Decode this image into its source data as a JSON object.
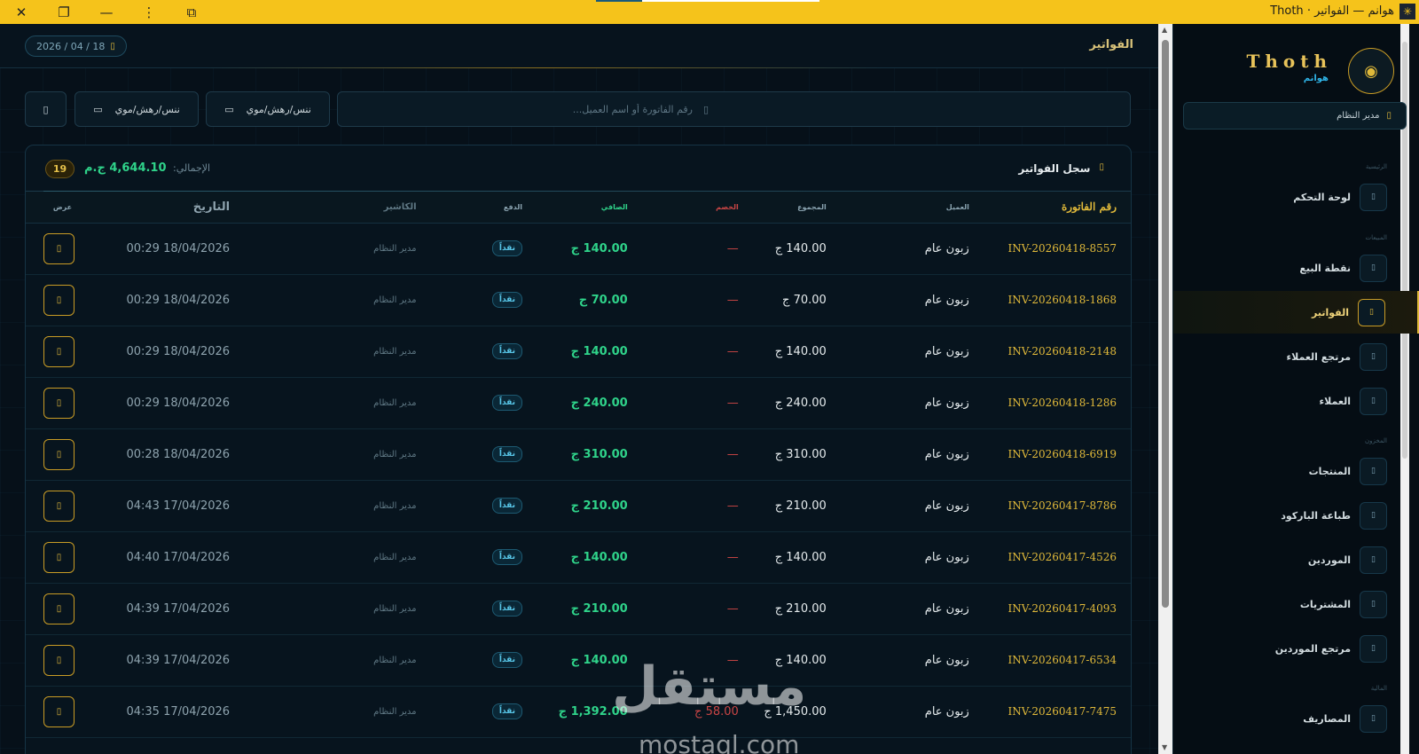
{
  "window": {
    "title": "هوانم — الفواتير · Thoth"
  },
  "header": {
    "page_title": "الفواتير",
    "date": "2026 / 04 / 18"
  },
  "filters": {
    "search_placeholder": "رقم الفاتورة أو اسم العميل...",
    "date_from_placeholder": "ﻧﻨﺲ/ﺭﻫﺶ/ﻣﻮﻱ",
    "date_to_placeholder": "ﻧﻨﺲ/ﺭﻫﺶ/ﻣﻮﻱ"
  },
  "card": {
    "title": "سجل الفواتير",
    "total_label": "الإجمالي:",
    "total_value": "4,644.10 ج.م",
    "count": "19"
  },
  "table": {
    "headers": {
      "invoice": "رقم الفاتورة",
      "customer": "العميل",
      "total": "المجموع",
      "discount": "الخصم",
      "net": "الصافي",
      "payment": "الدفع",
      "cashier": "الكاشير",
      "date": "التاريخ",
      "view": "عرض"
    },
    "rows": [
      {
        "invoice": "INV-20260418-8557",
        "customer": "زبون عام",
        "total": "140.00 ج",
        "discount": "—",
        "net": "140.00 ج",
        "payment": "نقداً",
        "cashier": "مدير النظام",
        "date": "18/04/2026 00:29"
      },
      {
        "invoice": "INV-20260418-1868",
        "customer": "زبون عام",
        "total": "70.00 ج",
        "discount": "—",
        "net": "70.00 ج",
        "payment": "نقداً",
        "cashier": "مدير النظام",
        "date": "18/04/2026 00:29"
      },
      {
        "invoice": "INV-20260418-2148",
        "customer": "زبون عام",
        "total": "140.00 ج",
        "discount": "—",
        "net": "140.00 ج",
        "payment": "نقداً",
        "cashier": "مدير النظام",
        "date": "18/04/2026 00:29"
      },
      {
        "invoice": "INV-20260418-1286",
        "customer": "زبون عام",
        "total": "240.00 ج",
        "discount": "—",
        "net": "240.00 ج",
        "payment": "نقداً",
        "cashier": "مدير النظام",
        "date": "18/04/2026 00:29"
      },
      {
        "invoice": "INV-20260418-6919",
        "customer": "زبون عام",
        "total": "310.00 ج",
        "discount": "—",
        "net": "310.00 ج",
        "payment": "نقداً",
        "cashier": "مدير النظام",
        "date": "18/04/2026 00:28"
      },
      {
        "invoice": "INV-20260417-8786",
        "customer": "زبون عام",
        "total": "210.00 ج",
        "discount": "—",
        "net": "210.00 ج",
        "payment": "نقداً",
        "cashier": "مدير النظام",
        "date": "17/04/2026 04:43"
      },
      {
        "invoice": "INV-20260417-4526",
        "customer": "زبون عام",
        "total": "140.00 ج",
        "discount": "—",
        "net": "140.00 ج",
        "payment": "نقداً",
        "cashier": "مدير النظام",
        "date": "17/04/2026 04:40"
      },
      {
        "invoice": "INV-20260417-4093",
        "customer": "زبون عام",
        "total": "210.00 ج",
        "discount": "—",
        "net": "210.00 ج",
        "payment": "نقداً",
        "cashier": "مدير النظام",
        "date": "17/04/2026 04:39"
      },
      {
        "invoice": "INV-20260417-6534",
        "customer": "زبون عام",
        "total": "140.00 ج",
        "discount": "—",
        "net": "140.00 ج",
        "payment": "نقداً",
        "cashier": "مدير النظام",
        "date": "17/04/2026 04:39"
      },
      {
        "invoice": "INV-20260417-7475",
        "customer": "زبون عام",
        "total": "1,450.00 ج",
        "discount": "58.00 ج",
        "net": "1,392.00 ج",
        "payment": "نقداً",
        "cashier": "مدير النظام",
        "date": "17/04/2026 04:35"
      }
    ]
  },
  "sidebar": {
    "brand": "Thoth",
    "brand_sub": "هوانم",
    "user": "مدير النظام",
    "sections": {
      "main": "الرئيسية",
      "sales": "المبيعات",
      "inventory": "المخزون",
      "finance": "المالية"
    },
    "items": [
      {
        "label": "لوحة التحكم"
      },
      {
        "label": "نقطة البيع"
      },
      {
        "label": "الفواتير"
      },
      {
        "label": "مرتجع العملاء"
      },
      {
        "label": "العملاء"
      },
      {
        "label": "المنتجات"
      },
      {
        "label": "طباعة الباركود"
      },
      {
        "label": "الموردين"
      },
      {
        "label": "المشتريات"
      },
      {
        "label": "مرتجع الموردين"
      },
      {
        "label": "المصاريف"
      }
    ]
  },
  "watermark": {
    "text": "مستقل",
    "sub": "mostaql.com"
  },
  "colors": {
    "accent_gold": "#e0b93a",
    "net_green": "#2fd38a",
    "titlebar_yellow": "#f5c31b",
    "discount_red": "#c94545"
  }
}
